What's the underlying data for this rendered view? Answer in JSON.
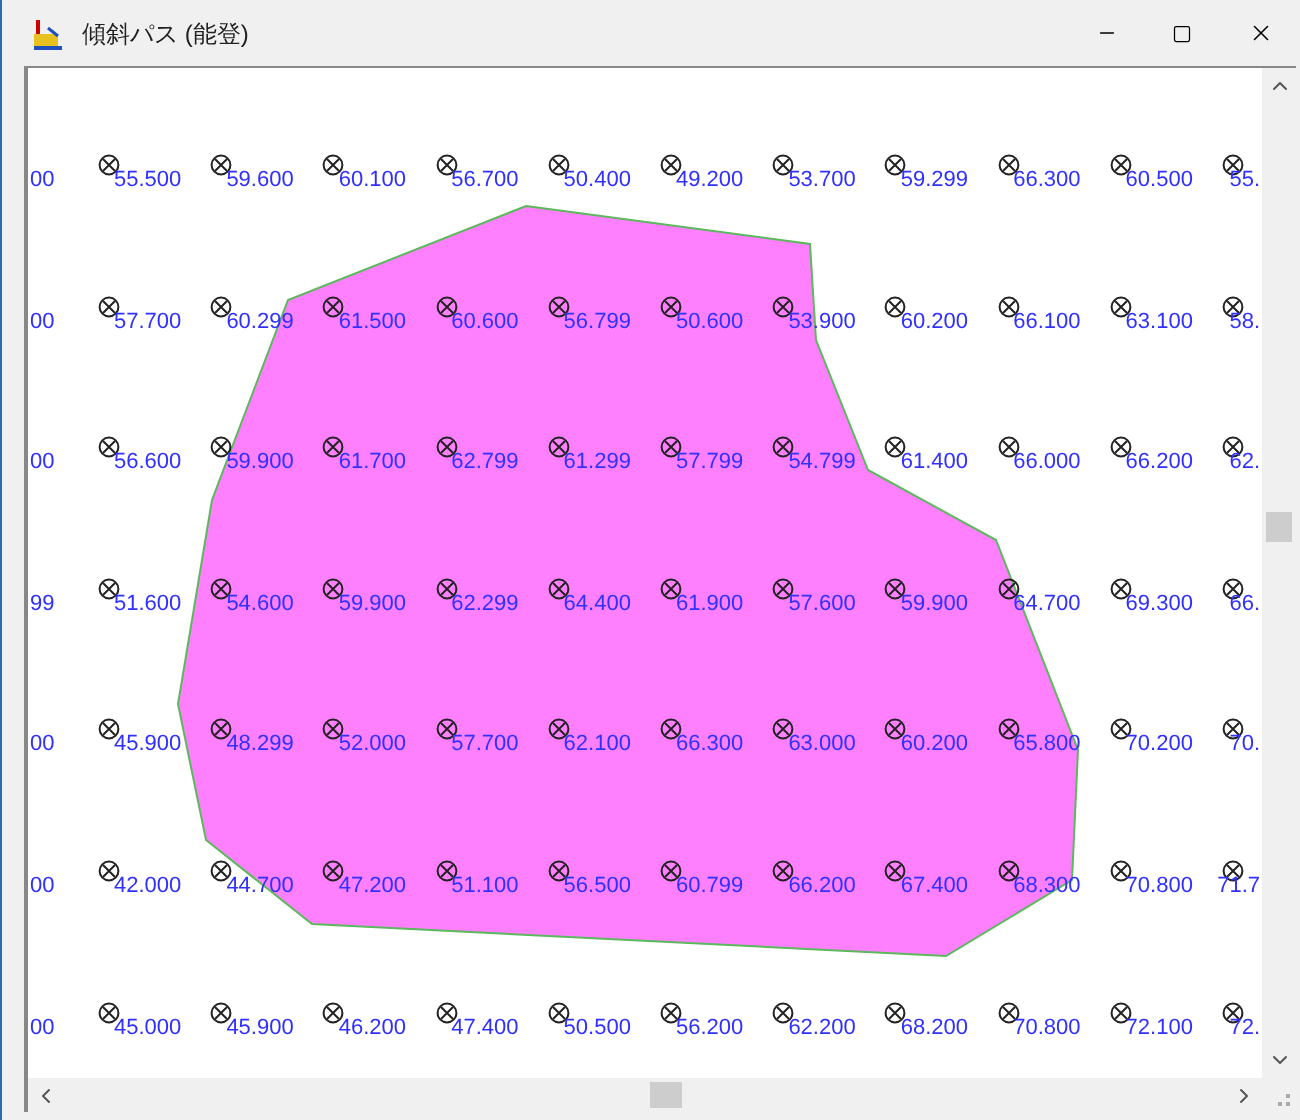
{
  "window": {
    "title": "傾斜パス (能登)"
  },
  "rows": [
    {
      "left_edge": "00",
      "points": [
        "55.500",
        "59.600",
        "60.100",
        "56.700",
        "50.400",
        "49.200",
        "53.700",
        "59.299",
        "66.300",
        "60.500"
      ],
      "right_edge": "55."
    },
    {
      "left_edge": "00",
      "points": [
        "57.700",
        "60.299",
        "61.500",
        "60.600",
        "56.799",
        "50.600",
        "53.900",
        "60.200",
        "66.100",
        "63.100"
      ],
      "right_edge": "58."
    },
    {
      "left_edge": "00",
      "points": [
        "56.600",
        "59.900",
        "61.700",
        "62.799",
        "61.299",
        "57.799",
        "54.799",
        "61.400",
        "66.000",
        "66.200"
      ],
      "right_edge": "62."
    },
    {
      "left_edge": "99",
      "points": [
        "51.600",
        "54.600",
        "59.900",
        "62.299",
        "64.400",
        "61.900",
        "57.600",
        "59.900",
        "64.700",
        "69.300"
      ],
      "right_edge": "66."
    },
    {
      "left_edge": "00",
      "points": [
        "45.900",
        "48.299",
        "52.000",
        "57.700",
        "62.100",
        "66.300",
        "63.000",
        "60.200",
        "65.800",
        "70.200"
      ],
      "right_edge": "70."
    },
    {
      "left_edge": "00",
      "points": [
        "42.000",
        "44.700",
        "47.200",
        "51.100",
        "56.500",
        "60.799",
        "66.200",
        "67.400",
        "68.300",
        "70.800"
      ],
      "right_edge": "71.7"
    },
    {
      "left_edge": "00",
      "points": [
        "45.000",
        "45.900",
        "46.200",
        "47.400",
        "50.500",
        "56.200",
        "62.200",
        "68.200",
        "70.800",
        "72.100"
      ],
      "right_edge": "72."
    }
  ]
}
